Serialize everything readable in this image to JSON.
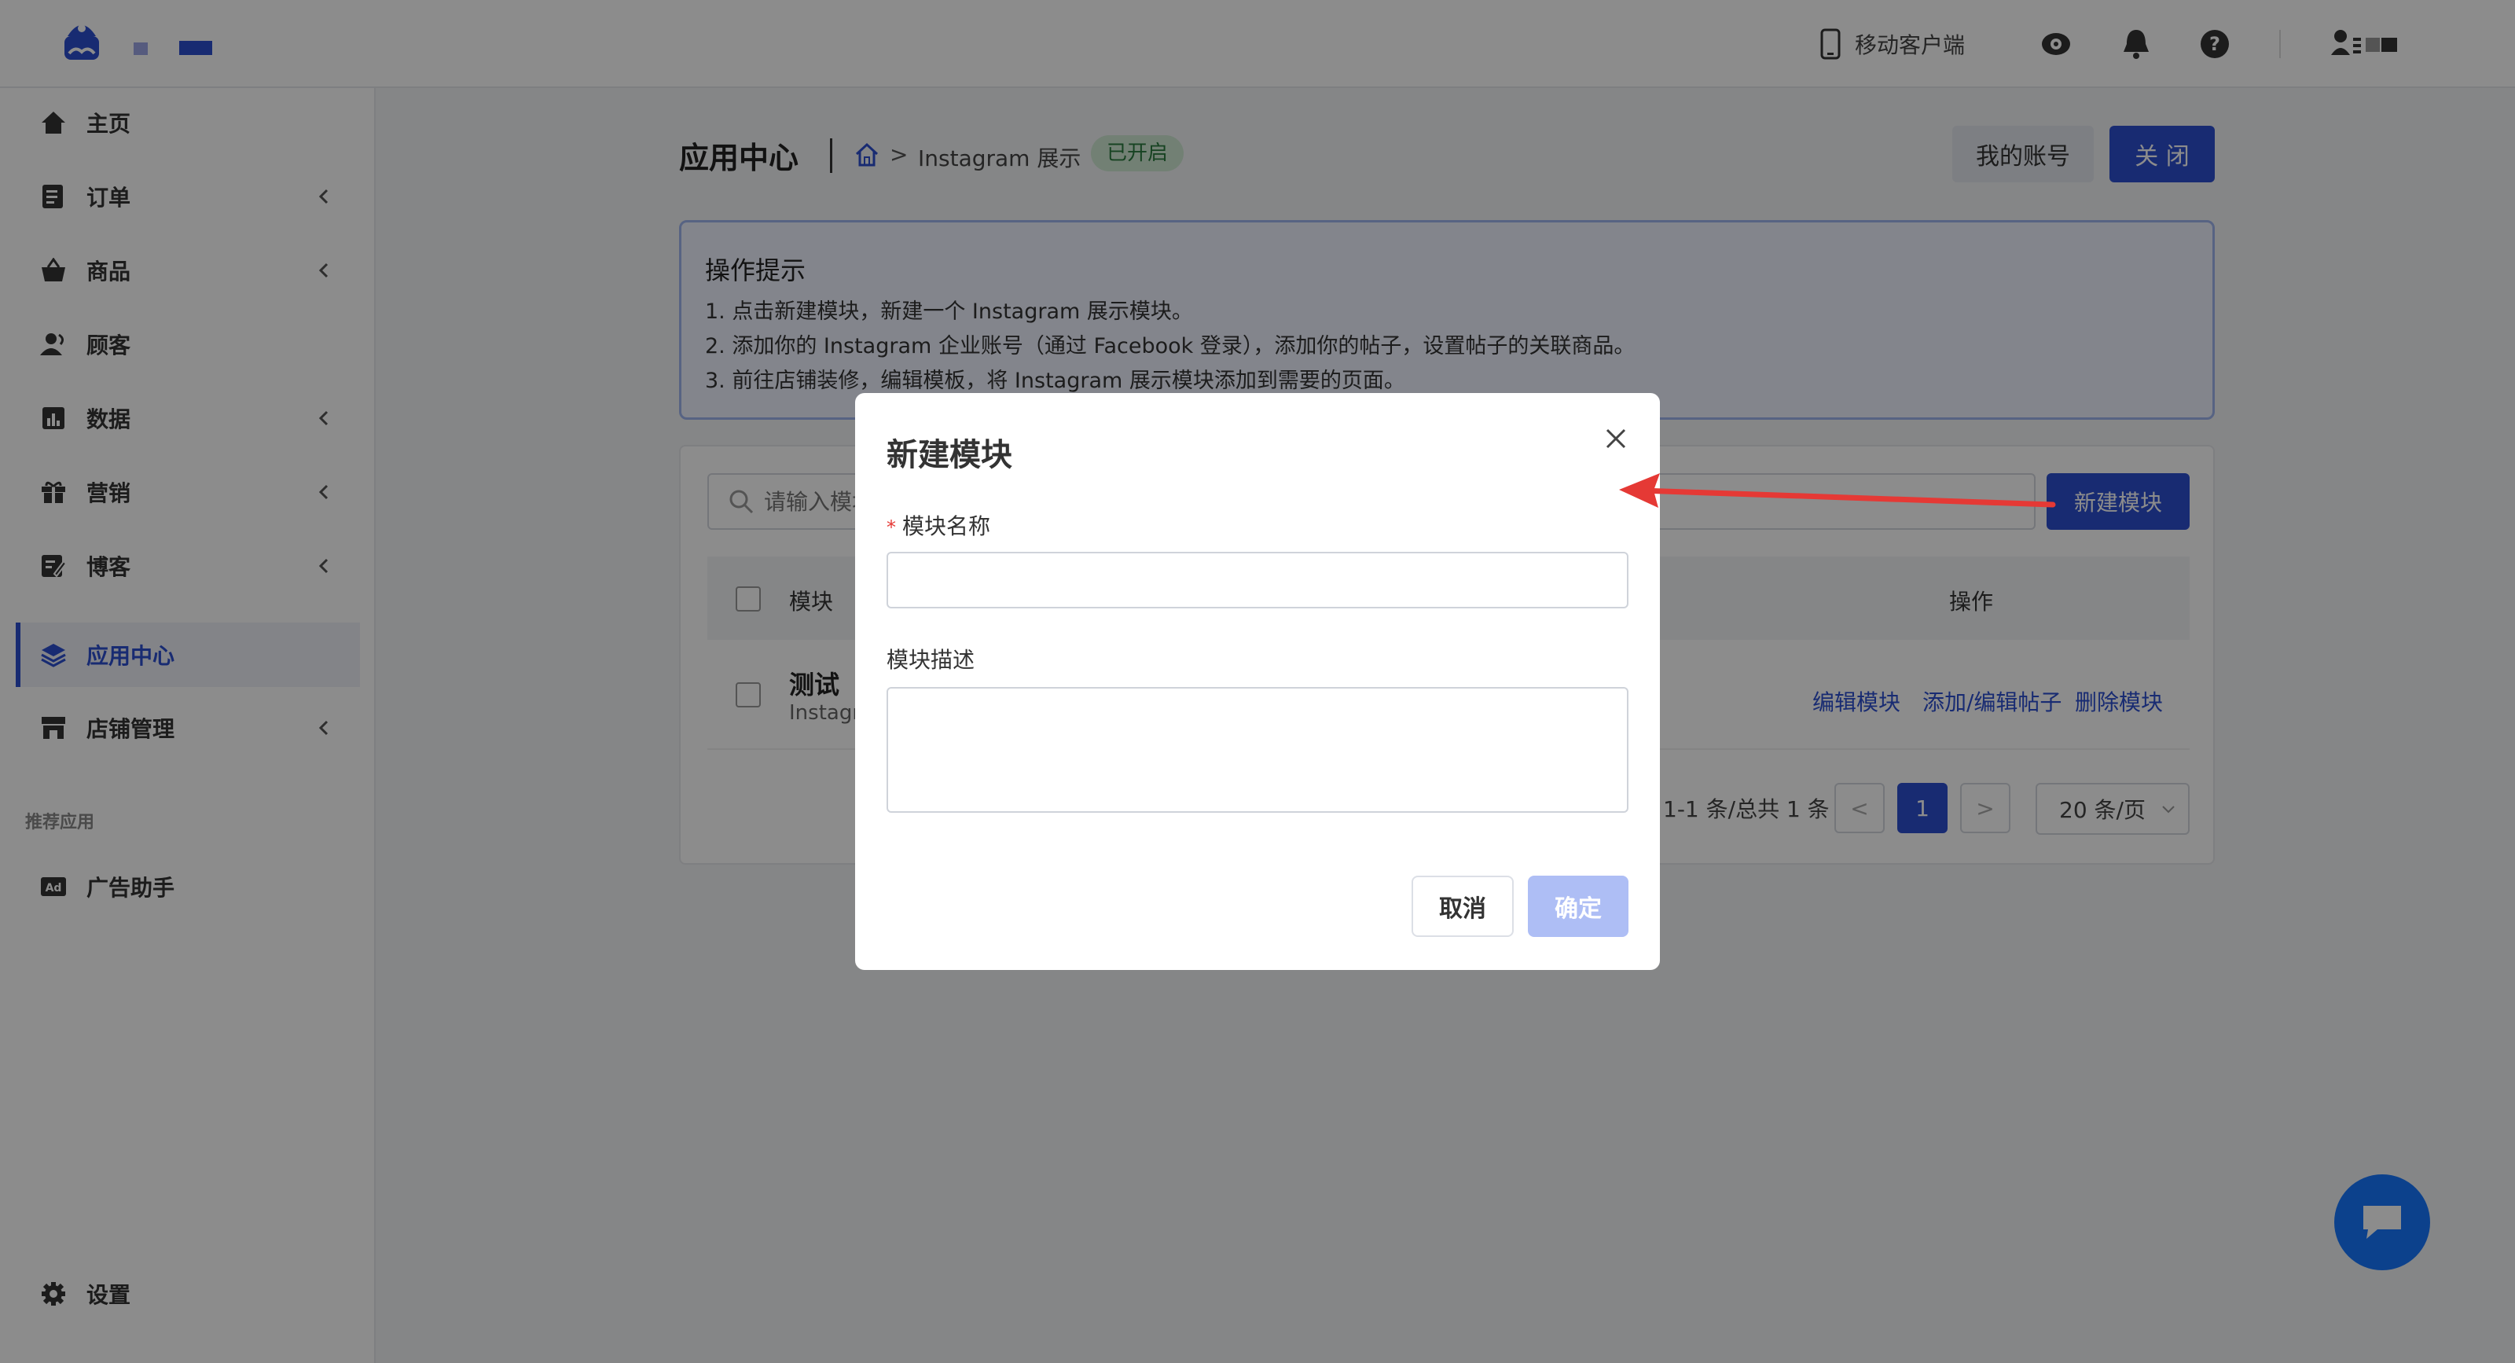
{
  "header": {
    "mobile_client": "移动客户端",
    "icons": [
      "eye-icon",
      "bell-icon",
      "help-icon",
      "user-switch-icon"
    ]
  },
  "sidebar": {
    "items": [
      {
        "label": "主页",
        "icon": "home-icon"
      },
      {
        "label": "订单",
        "icon": "order-icon"
      },
      {
        "label": "商品",
        "icon": "basket-icon"
      },
      {
        "label": "顾客",
        "icon": "customer-icon"
      },
      {
        "label": "数据",
        "icon": "chart-icon"
      },
      {
        "label": "营销",
        "icon": "gift-icon"
      },
      {
        "label": "博客",
        "icon": "blog-icon"
      },
      {
        "label": "应用中心",
        "icon": "layers-icon"
      },
      {
        "label": "店铺管理",
        "icon": "store-icon"
      }
    ],
    "recommended_label": "推荐应用",
    "recommended_items": [
      {
        "label": "广告助手",
        "icon": "ad-icon"
      }
    ],
    "settings_label": "设置"
  },
  "page": {
    "title": "应用中心",
    "breadcrumb_gt": ">",
    "breadcrumb": "Instagram 展示",
    "status": "已开启",
    "my_account": "我的账号",
    "close": "关 闭"
  },
  "tips": {
    "title": "操作提示",
    "lines": [
      "1. 点击新建模块，新建一个 Instagram 展示模块。",
      "2. 添加你的 Instagram 企业账号（通过 Facebook 登录），添加你的帖子，设置帖子的关联商品。",
      "3. 前往店铺装修，编辑模板，将 Instagram 展示模块添加到需要的页面。"
    ]
  },
  "list": {
    "search_placeholder": "请输入模块名称",
    "new_module": "新建模块",
    "col_module": "模块",
    "col_actions": "操作",
    "rows": [
      {
        "title": "测试",
        "subtitle": "Instagram",
        "actions": [
          "编辑模块",
          "添加/编辑帖子",
          "删除模块"
        ]
      }
    ],
    "pager_info": "1-1 条/总共 1 条",
    "page_prev": "<",
    "current_page": "1",
    "page_next": ">",
    "page_size": "20 条/页"
  },
  "modal": {
    "title": "新建模块",
    "required_mark": "*",
    "name_label": "模块名称",
    "name_value": "",
    "desc_label": "模块描述",
    "desc_value": "",
    "cancel": "取消",
    "ok": "确定"
  },
  "colors": {
    "primary": "#2d4fcf",
    "annotation_arrow": "#e53935",
    "status_green": "#2b7a3e",
    "chat_blue": "#1677ff"
  }
}
